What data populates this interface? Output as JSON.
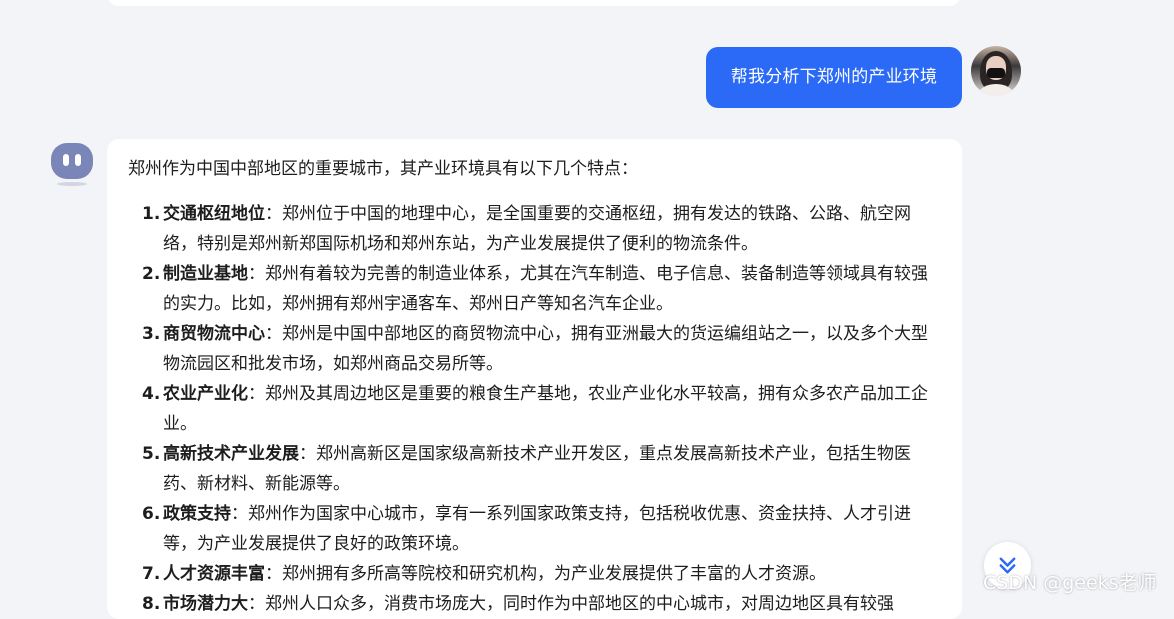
{
  "conversation": {
    "user_message": "帮我分析下郑州的产业环境",
    "answer": {
      "intro": "郑州作为中国中部地区的重要城市，其产业环境具有以下几个特点：",
      "points": [
        {
          "num": "1.",
          "term": "交通枢纽地位",
          "text": "：郑州位于中国的地理中心，是全国重要的交通枢纽，拥有发达的铁路、公路、航空网络，特别是郑州新郑国际机场和郑州东站，为产业发展提供了便利的物流条件。"
        },
        {
          "num": "2.",
          "term": "制造业基地",
          "text": "：郑州有着较为完善的制造业体系，尤其在汽车制造、电子信息、装备制造等领域具有较强的实力。比如，郑州拥有郑州宇通客车、郑州日产等知名汽车企业。"
        },
        {
          "num": "3.",
          "term": "商贸物流中心",
          "text": "：郑州是中国中部地区的商贸物流中心，拥有亚洲最大的货运编组站之一，以及多个大型物流园区和批发市场，如郑州商品交易所等。"
        },
        {
          "num": "4.",
          "term": "农业产业化",
          "text": "：郑州及其周边地区是重要的粮食生产基地，农业产业化水平较高，拥有众多农产品加工企业。"
        },
        {
          "num": "5.",
          "term": "高新技术产业发展",
          "text": "：郑州高新区是国家级高新技术产业开发区，重点发展高新技术产业，包括生物医药、新材料、新能源等。"
        },
        {
          "num": "6.",
          "term": "政策支持",
          "text": "：郑州作为国家中心城市，享有一系列国家政策支持，包括税收优惠、资金扶持、人才引进等，为产业发展提供了良好的政策环境。"
        },
        {
          "num": "7.",
          "term": "人才资源丰富",
          "text": "：郑州拥有多所高等院校和研究机构，为产业发展提供了丰富的人才资源。"
        },
        {
          "num": "8.",
          "term": "市场潜力大",
          "text": "：郑州人口众多，消费市场庞大，同时作为中部地区的中心城市，对周边地区具有较强"
        }
      ]
    }
  },
  "watermark": "CSDN @geeks老师",
  "icons": {
    "user_avatar": "user-avatar-photo",
    "bot_avatar": "bot-avatar-icon",
    "scroll": "chevrons-down-icon"
  },
  "colors": {
    "user_bubble": "#2b6af6",
    "bot_avatar": "#7b86b8",
    "scroll_icon": "#2b6af6"
  }
}
